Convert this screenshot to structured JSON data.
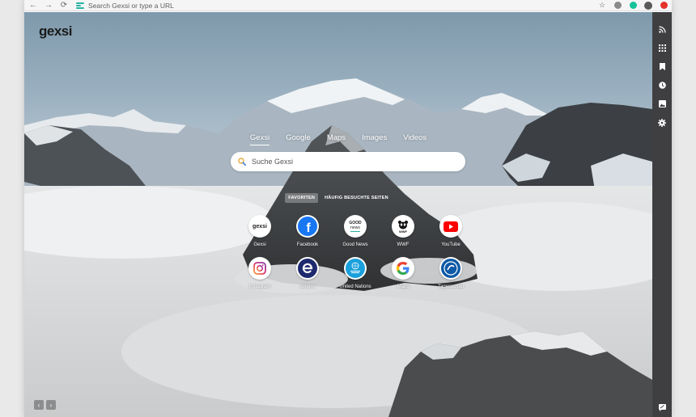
{
  "browser": {
    "address_placeholder": "Search Gexsi or type a URL",
    "nav": {
      "back": "←",
      "forward": "→",
      "reload": "⟳"
    },
    "toolbar_icons": [
      "star-icon",
      "extension-icon",
      "grammarly-icon",
      "profile-avatar",
      "adblock-icon"
    ]
  },
  "page": {
    "logo": "gexsi",
    "search_tabs": [
      "Gexsi",
      "Google",
      "Maps",
      "Images",
      "Videos"
    ],
    "active_search_tab": "Gexsi",
    "search_placeholder": "Suche Gexsi",
    "favorites_tabs": [
      "FAVORITEN",
      "HÄUFIG BESUCHTE SEITEN"
    ],
    "tiles": [
      {
        "label": "Gexsi",
        "icon": "gexsi-icon"
      },
      {
        "label": "Facebook",
        "icon": "facebook-icon"
      },
      {
        "label": "Good News",
        "icon": "good-news-icon"
      },
      {
        "label": "WWF",
        "icon": "wwf-icon"
      },
      {
        "label": "YouTube",
        "icon": "youtube-icon"
      },
      {
        "label": "Instagram",
        "icon": "instagram-icon"
      },
      {
        "label": "Enorm",
        "icon": "enorm-icon"
      },
      {
        "label": "United Nations",
        "icon": "united-nations-icon"
      },
      {
        "label": "Maps",
        "icon": "google-maps-icon"
      },
      {
        "label": "Tagesschau",
        "icon": "tagesschau-icon"
      }
    ],
    "icon_texts": {
      "gexsi": "gexsi",
      "good": "GOOD",
      "news": "news",
      "wwf": "WWF"
    },
    "pager": {
      "prev": "‹",
      "next": "›"
    }
  },
  "sidebar": {
    "icons": [
      "rss-icon",
      "apps-grid-icon",
      "bookmark-icon",
      "history-icon",
      "image-icon",
      "settings-gear-icon"
    ],
    "bottom_icon": "feedback-icon"
  },
  "colors": {
    "sidebar_bg": "#3f3f41",
    "youtube_red": "#ff0000",
    "facebook_blue": "#1877f2",
    "enorm_navy": "#1e2a6e",
    "un_blue": "#1aa0dc",
    "tagesschau_blue": "#0d5aa7"
  }
}
